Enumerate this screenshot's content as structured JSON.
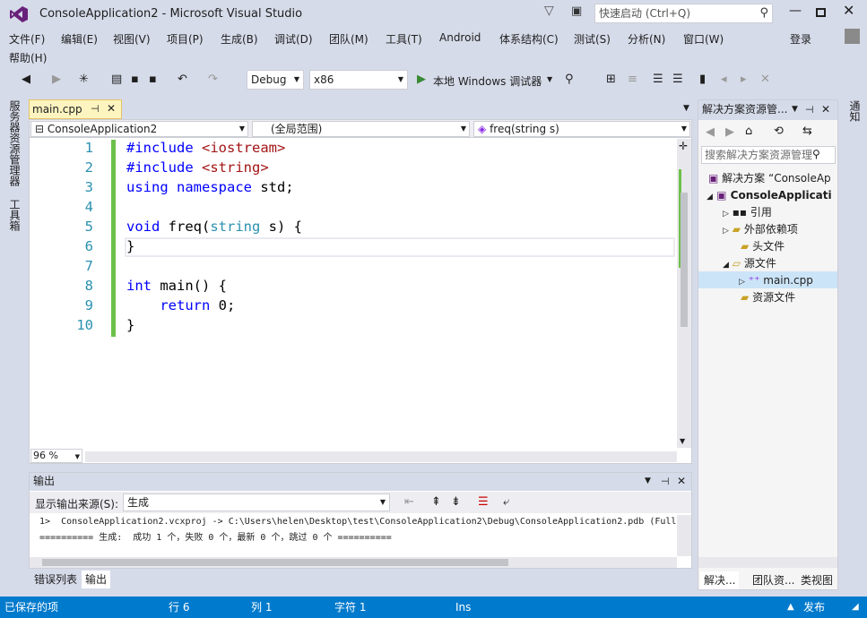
{
  "window": {
    "title": "ConsoleApplication2 - Microsoft Visual Studio",
    "quick_launch_placeholder": "快速启动 (Ctrl+Q)",
    "sign_in": "登录"
  },
  "menu": [
    "文件(F)",
    "编辑(E)",
    "视图(V)",
    "项目(P)",
    "生成(B)",
    "调试(D)",
    "团队(M)",
    "工具(T)",
    "Android",
    "体系结构(C)",
    "测试(S)",
    "分析(N)",
    "窗口(W)",
    "帮助(H)"
  ],
  "toolbar": {
    "config": "Debug",
    "platform": "x86",
    "debugger": "本地 Windows 调试器"
  },
  "left_strip": {
    "server_explorer": "服务器资源管理器",
    "toolbox": "工具箱"
  },
  "right_strip": {
    "notifications": "通知"
  },
  "document_tab": {
    "name": "main.cpp"
  },
  "navbar": {
    "project": "ConsoleApplication2",
    "scope": "(全局范围)",
    "member": "freq(string s)"
  },
  "code_lines": [
    {
      "n": "1",
      "tokens": [
        {
          "t": "#include ",
          "c": "kw"
        },
        {
          "t": "<iostream>",
          "c": "inc"
        }
      ]
    },
    {
      "n": "2",
      "tokens": [
        {
          "t": "#include ",
          "c": "kw"
        },
        {
          "t": "<string>",
          "c": "inc"
        }
      ]
    },
    {
      "n": "3",
      "tokens": [
        {
          "t": "using namespace ",
          "c": "kw"
        },
        {
          "t": "std;",
          "c": ""
        }
      ]
    },
    {
      "n": "4",
      "tokens": []
    },
    {
      "n": "5",
      "tokens": [
        {
          "t": "void ",
          "c": "kw"
        },
        {
          "t": "freq(",
          "c": ""
        },
        {
          "t": "string",
          "c": "ty"
        },
        {
          "t": " s) {",
          "c": ""
        }
      ]
    },
    {
      "n": "6",
      "tokens": [
        {
          "t": "}",
          "c": ""
        }
      ]
    },
    {
      "n": "7",
      "tokens": []
    },
    {
      "n": "8",
      "tokens": [
        {
          "t": "int ",
          "c": "kw"
        },
        {
          "t": "main() {",
          "c": ""
        }
      ]
    },
    {
      "n": "9",
      "tokens": [
        {
          "t": "    return ",
          "c": "kw"
        },
        {
          "t": "0;",
          "c": ""
        }
      ]
    },
    {
      "n": "10",
      "tokens": [
        {
          "t": "}",
          "c": ""
        }
      ]
    }
  ],
  "editor": {
    "zoom": "96 %"
  },
  "output": {
    "title": "输出",
    "source_label": "显示输出来源(S):",
    "source_value": "生成",
    "lines": [
      "1>  ConsoleApplication2.vcxproj -> C:\\Users\\helen\\Desktop\\test\\ConsoleApplication2\\Debug\\ConsoleApplication2.pdb (Full",
      "========== 生成:  成功 1 个，失败 0 个，最新 0 个，跳过 0 个 =========="
    ]
  },
  "bottom_tabs": [
    "错误列表",
    "输出"
  ],
  "solution_explorer": {
    "title": "解决方案资源管...",
    "search_placeholder": "搜索解决方案资源管理",
    "tree": [
      "解决方案 “ConsoleAp",
      "ConsoleApplicati",
      "引用",
      "外部依赖项",
      "头文件",
      "源文件",
      "main.cpp",
      "资源文件"
    ],
    "tabs": [
      "解决...",
      "团队资...",
      "类视图"
    ]
  },
  "status": {
    "left": "已保存的项",
    "line": "行 6",
    "col": "列 1",
    "char": "字符 1",
    "mode": "Ins",
    "publish": "发布"
  }
}
